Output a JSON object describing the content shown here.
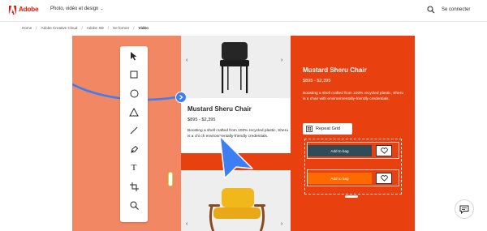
{
  "topnav": {
    "brand": "Adobe",
    "menu_label": "Photo, vidéo et design",
    "signin_label": "Se connecter"
  },
  "breadcrumb": [
    "Home",
    "Adobe Creative Cloud",
    "Adobe XD",
    "Se former",
    "Vidéo"
  ],
  "hero": {
    "card": {
      "name": "Mustard Sheru Chair",
      "price": "$895 - $2,395",
      "description": "Boosting a shell crafted from 100% recycled plastic, Sheru is a chair with environmentally-friendly credentials."
    },
    "card_covered_description": "Boosting a shell crafted from 100% recycled plastic, Sheru is a chi ch environmentally-friendly credentials.",
    "panel": {
      "name": "Mustard Sheru Chair",
      "price": "$895 - $2,395",
      "description": "Boosting a shell crafted from 100% recycled plastic, Sheru is a chair with environmentally-friendly credentials.",
      "repeat_grid_label": "Repeat Grid",
      "add_to_bag_label": "Add to bag"
    },
    "toolbar_tools": [
      "select-tool",
      "rectangle-tool",
      "ellipse-tool",
      "triangle-tool",
      "line-tool",
      "pen-tool",
      "text-tool",
      "artboard-tool",
      "zoom-tool"
    ],
    "colors": {
      "hero_salmon": "#f28763",
      "hero_orange": "#e8400f",
      "cursor_blue": "#3d7ef2",
      "button_dark": "#2f4d58",
      "button_orange": "#ff6a00"
    }
  },
  "icons": {
    "search": "search-icon",
    "chat": "chat-icon"
  }
}
